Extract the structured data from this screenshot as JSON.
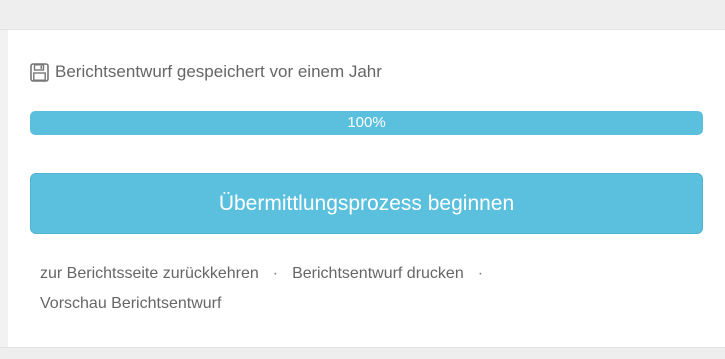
{
  "status": {
    "icon": "floppy-disk-icon",
    "text": "Berichtsentwurf gespeichert vor einem Jahr"
  },
  "progress": {
    "value_percent": 100,
    "label": "100%"
  },
  "actions": {
    "submit_label": "Übermittlungsprozess beginnen"
  },
  "links": {
    "back_label": "zur Berichtsseite zurückkehren",
    "print_label": "Berichtsentwurf drucken",
    "preview_label": "Vorschau Berichtsentwurf",
    "separator": "·"
  },
  "colors": {
    "accent": "#5bc0de",
    "text": "#666666",
    "band": "#eeeeee"
  }
}
